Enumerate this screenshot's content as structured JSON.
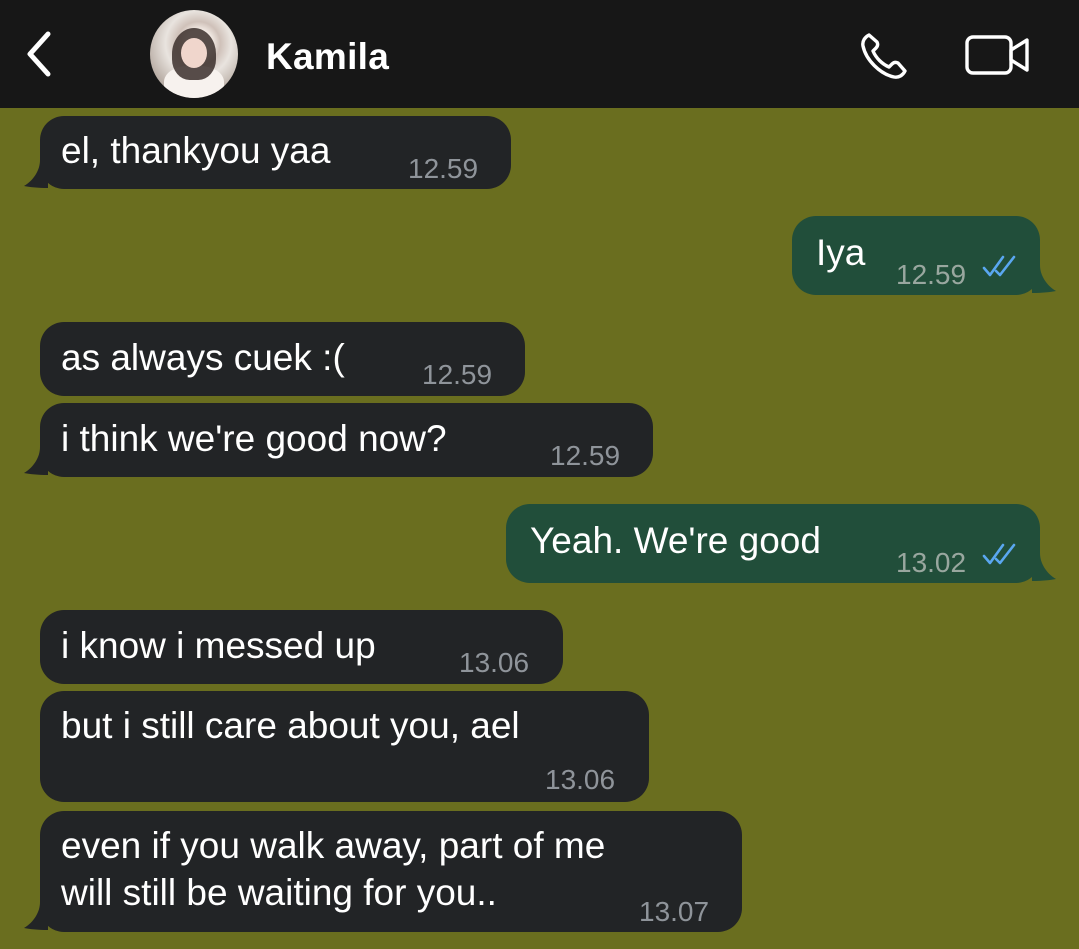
{
  "header": {
    "contact_name": "Kamila",
    "back_icon": "chevron-left-icon",
    "call_icon": "phone-icon",
    "video_icon": "video-camera-icon",
    "background": "#171717"
  },
  "chat": {
    "background": "#6a6e1f",
    "incoming_bubble_color": "#222426",
    "outgoing_bubble_color": "#214e3a",
    "read_tick_color": "#5aa7f0",
    "messages": [
      {
        "direction": "incoming",
        "text": "el, thankyou yaa",
        "time": "12.59"
      },
      {
        "direction": "outgoing",
        "text": "Iya",
        "time": "12.59",
        "status": "read"
      },
      {
        "direction": "incoming",
        "text": "as always cuek :(",
        "time": "12.59"
      },
      {
        "direction": "incoming",
        "text": "i think we're good now?",
        "time": "12.59"
      },
      {
        "direction": "outgoing",
        "text": "Yeah. We're good",
        "time": "13.02",
        "status": "read"
      },
      {
        "direction": "incoming",
        "text": "i know i messed up",
        "time": "13.06"
      },
      {
        "direction": "incoming",
        "text": "but i still care about you, ael",
        "time": "13.06"
      },
      {
        "direction": "incoming",
        "text_line1": "even if you walk away, part of me",
        "text_line2": "will still be waiting for you..",
        "time": "13.07"
      }
    ]
  }
}
